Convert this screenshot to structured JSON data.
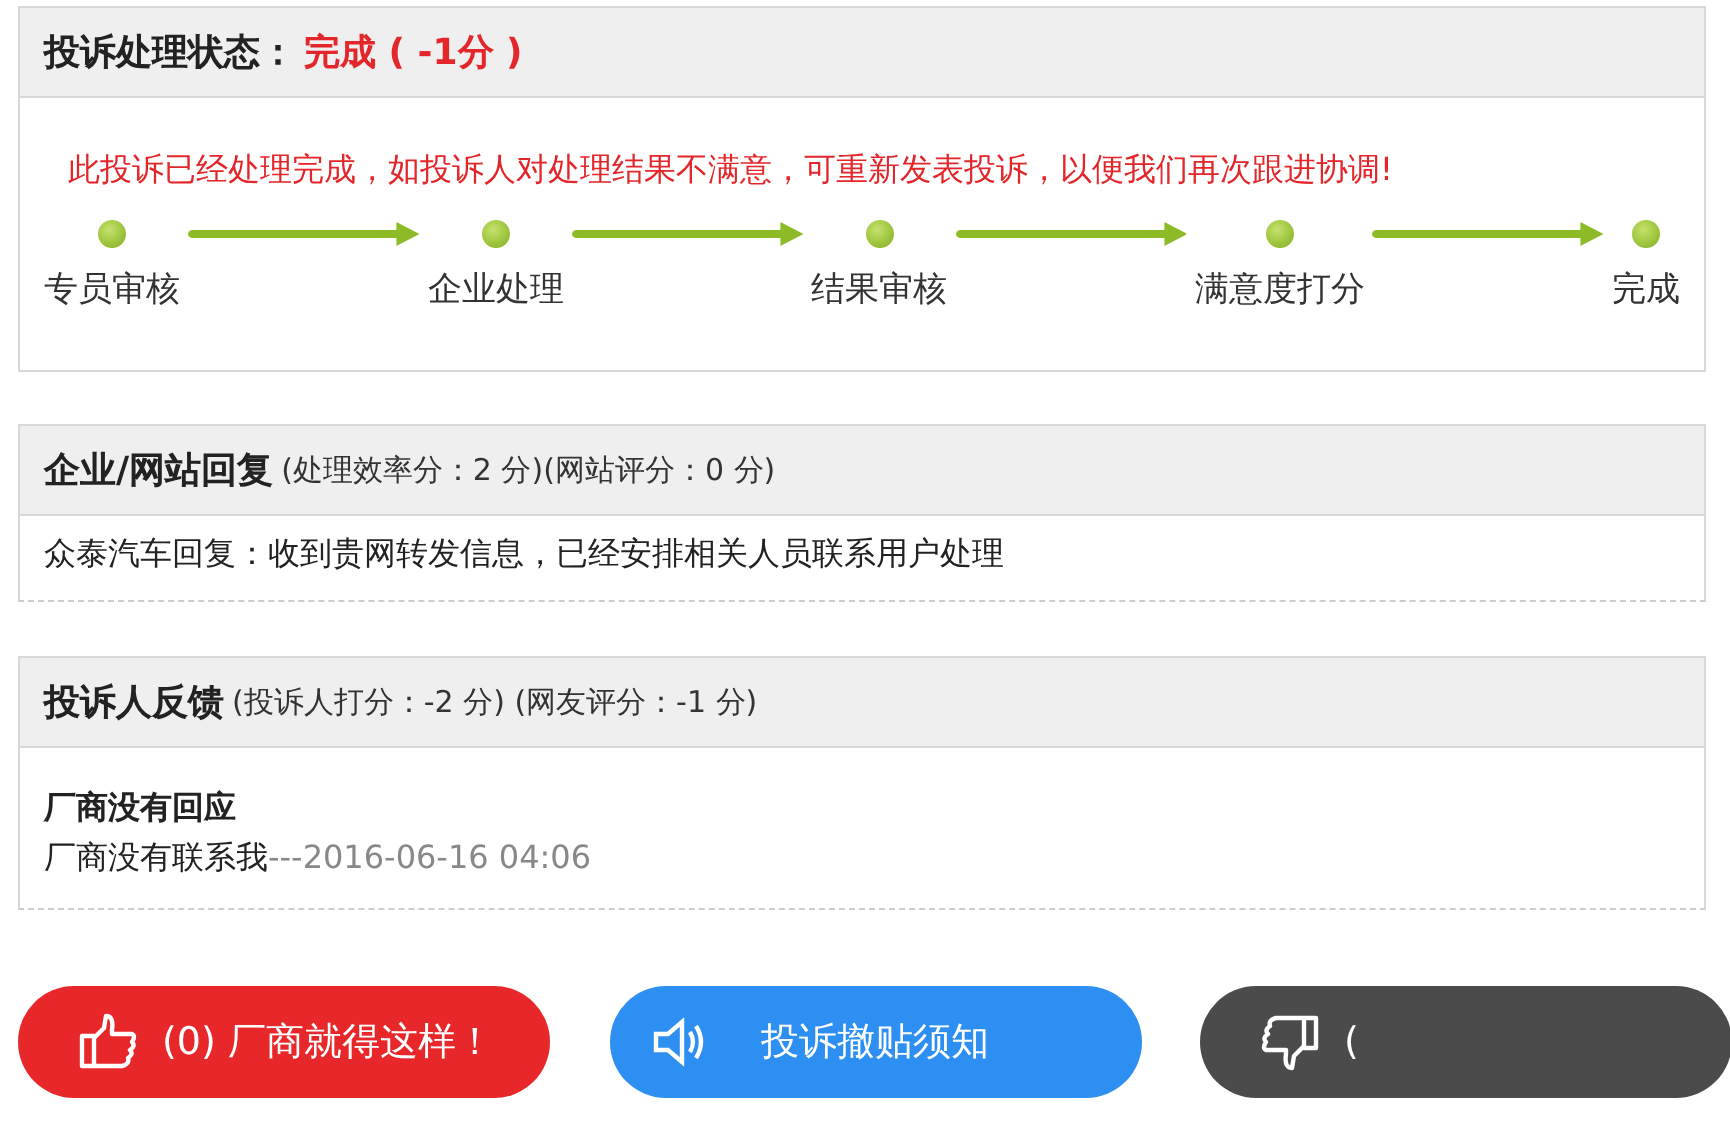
{
  "status_panel": {
    "title": "投诉处理状态：",
    "status": "完成 ( -1分 )",
    "notice": "此投诉已经处理完成，如投诉人对处理结果不满意，可重新发表投诉，以便我们再次跟进协调!",
    "steps": [
      {
        "label": "专员审核"
      },
      {
        "label": "企业处理"
      },
      {
        "label": "结果审核"
      },
      {
        "label": "满意度打分"
      },
      {
        "label": "完成"
      }
    ]
  },
  "reply_panel": {
    "title": "企业/网站回复",
    "scores": "(处理效率分：2 分)(网站评分：0 分)",
    "reply": "众泰汽车回复：收到贵网转发信息，已经安排相关人员联系用户处理"
  },
  "feedback_panel": {
    "title": "投诉人反馈",
    "scores": "(投诉人打分：-2 分) (网友评分：-1 分)",
    "heading": "厂商没有回应",
    "message": "厂商没有联系我",
    "timestamp": "---2016-06-16 04:06"
  },
  "buttons": [
    {
      "kind": "thumbs-up",
      "label": "(0) 厂商就得这样！",
      "color": "#e8272b"
    },
    {
      "kind": "speaker",
      "label": "投诉撤贴须知",
      "color": "#2e8ff2"
    },
    {
      "kind": "thumbs-down",
      "label": "(",
      "color": "#4b4b4b"
    }
  ]
}
